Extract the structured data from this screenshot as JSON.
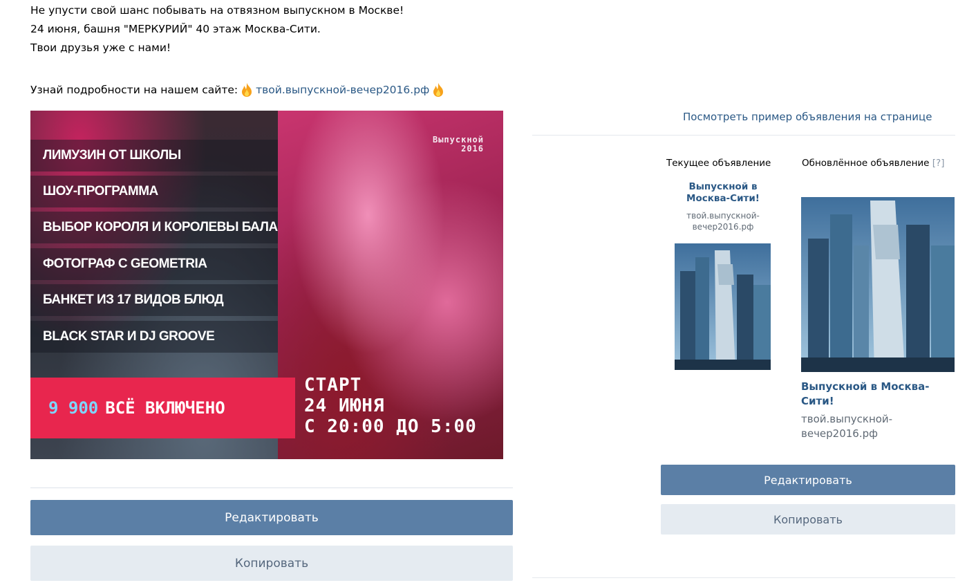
{
  "post": {
    "lines": [
      "Не упусти свой шанс побывать на отвязном выпускном в Москве!",
      "24 июня, башня \"МЕРКУРИЙ\" 40 этаж Москва-Сити.",
      "Твои друзья уже с нами!"
    ],
    "details_prefix": "Узнай подробности на нашем сайте:",
    "details_link": "твой.выпускной-вечер2016.рф"
  },
  "banner": {
    "tag_line1": "Выпускной",
    "tag_line2": "2016",
    "features": [
      "ЛИМУЗИН ОТ ШКОЛЫ",
      "ШОУ-ПРОГРАММА",
      "ВЫБОР КОРОЛЯ И КОРОЛЕВЫ БАЛА",
      "ФОТОГРАФ С GEOMETRIA",
      "БАНКЕТ ИЗ 17 ВИДОВ БЛЮД",
      "BLACK STAR И DJ GROOVE"
    ],
    "price_number": "9 900",
    "price_text": "ВСЁ ВКЛЮЧЕНО",
    "start_line1": "СТАРТ",
    "start_line2": "24 ИЮНЯ",
    "start_line3": "С 20:00 ДО 5:00"
  },
  "left_actions": {
    "edit_label": "Редактировать",
    "copy_label": "Копировать"
  },
  "right_panel": {
    "view_link": "Посмотреть пример объявления на странице",
    "current_header": "Текущее объявление",
    "updated_header": "Обновлённое объявление",
    "help_mark": "[?]",
    "current_ad": {
      "title": "Выпускной в Москва-Сити!",
      "url": "твой.выпускной-вечер2016.рф"
    },
    "updated_ad": {
      "title": "Выпускной в Москва-Сити!",
      "url": "твой.выпускной-вечер2016.рф"
    },
    "edit_label": "Редактировать",
    "copy_label": "Копировать"
  },
  "colors": {
    "link": "#2a5885",
    "primary_button": "#5b7fa6",
    "secondary_button": "#e5ebf1",
    "banner_price_bar": "#e8264e"
  },
  "icons": {
    "fire": "fire-emoji-icon"
  }
}
